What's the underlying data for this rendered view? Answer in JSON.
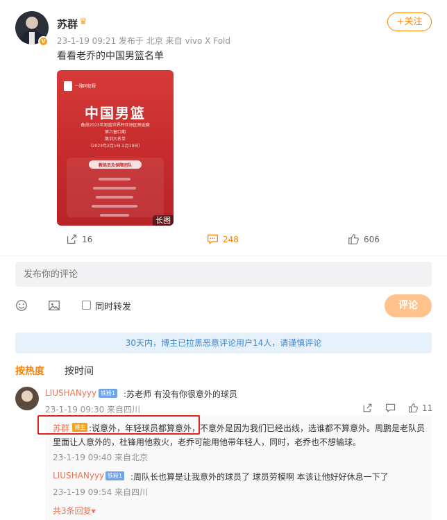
{
  "post": {
    "author": "苏群",
    "verified_badge": "V",
    "crown_icon": "crown-icon",
    "meta": "23-1-19 09:21  发布于 北京  来自 vivo X Fold",
    "follow_label": "+关注",
    "text": "看看老乔的中国男篮名单",
    "image": {
      "logo_text": "一路同征程",
      "title": "中国男篮",
      "lines": [
        "备战2023年男篮世界杯亚洲区预选赛",
        "第六窗口期",
        "集训大名单",
        "（2023年2月1日-2月19日）"
      ],
      "section_label": "教练员及保障团队",
      "tag": "长图"
    },
    "actions": {
      "share_count": "16",
      "comment_count": "248",
      "like_count": "606"
    }
  },
  "composer": {
    "placeholder": "发布你的评论",
    "repost_label": "同时转发",
    "submit_label": "评论"
  },
  "notice": "30天内，博主已拉黑恶意评论用户14人，请谨慎评论",
  "sort": {
    "hot": "按热度",
    "time": "按时间"
  },
  "comments": [
    {
      "user": "LIUSHANyyy",
      "badge": "铁粉1",
      "text": ":苏老师 有没有你很意外的球员",
      "time": "23-1-19 09:30 来自四川",
      "like_count": "11",
      "replies": [
        {
          "user": "苏群",
          "badge": "博主",
          "text": ":说意外，年轻球员都算意外，不意外是因为我们已经出线，选谁都不算意外。周鹏是老队员里面让人意外的，杜锋用他救火，老乔可能用他带年轻人，同时，老乔也不想输球。",
          "time": "23-1-19 09:40 来自北京"
        },
        {
          "user": "LIUSHANyyy",
          "badge": "铁粉1",
          "text": ":周队长也算是让我意外的球员了 球员劳模啊 本该让他好好休息一下了",
          "time": "23-1-19 09:54 来自四川"
        }
      ],
      "more_label": "共3条回复▾"
    }
  ]
}
